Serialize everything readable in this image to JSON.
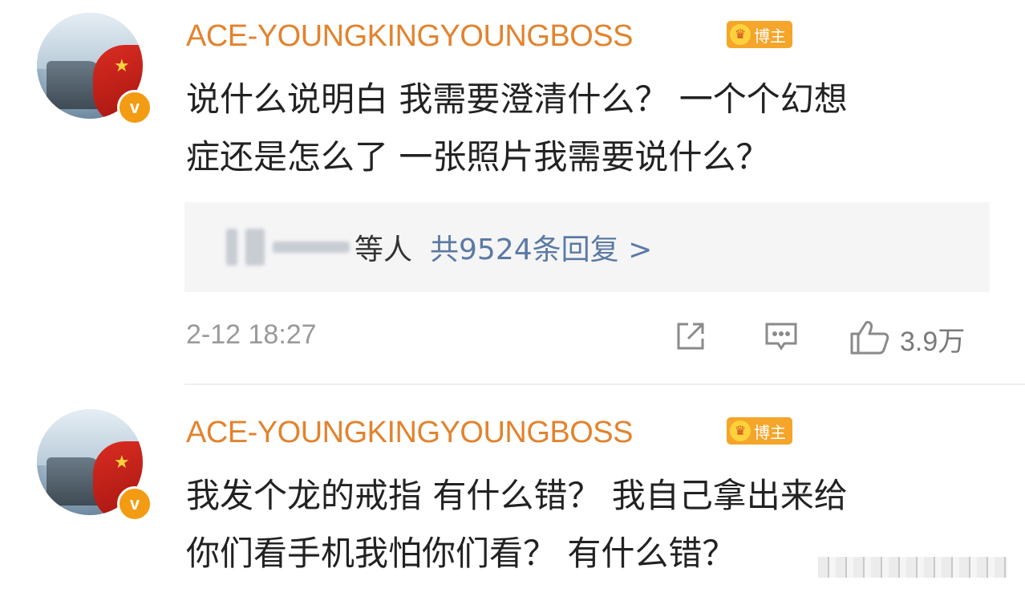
{
  "comments": [
    {
      "username": "ACE-YOUNGKINGYOUNGBOSS",
      "badge_label": "博主",
      "text": "说什么说明白 我需要澄清什么？ 一个个幻想\n症还是怎么了 一张照片我需要说什么？",
      "reply_preview": {
        "suffix": "等人",
        "count_link": "共9524条回复 >"
      },
      "timestamp": "2-12 18:27",
      "like_count": "3.9万"
    },
    {
      "username": "ACE-YOUNGKINGYOUNGBOSS",
      "badge_label": "博主",
      "text": "我发个龙的戒指 有什么错？ 我自己拿出来给\n你们看手机我怕你们看？ 有什么错？"
    }
  ],
  "icons": {
    "verified": "verified-v-icon",
    "crown": "crown-icon",
    "share": "share-icon",
    "comment": "comment-icon",
    "like": "thumbs-up-icon"
  },
  "colors": {
    "username": "#e2832e",
    "badge": "#f4a52a",
    "link": "#5b7aa3",
    "text": "#222222",
    "meta": "#9a9a9a"
  }
}
